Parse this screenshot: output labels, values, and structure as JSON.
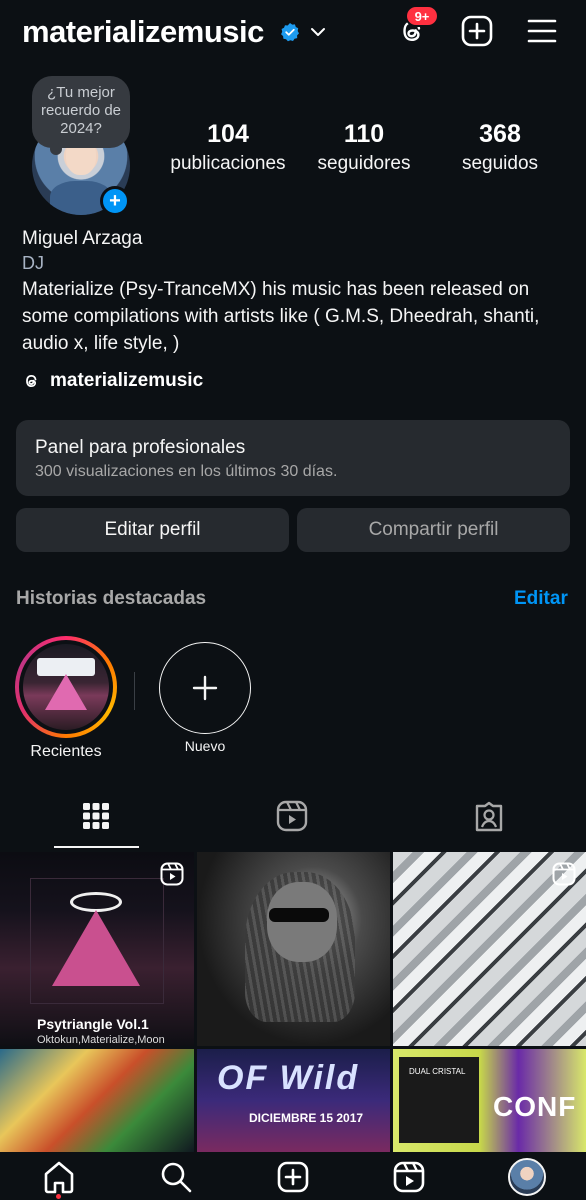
{
  "header": {
    "username": "materializemusic",
    "notification_badge": "9+",
    "icons": [
      "threads-icon",
      "create-icon",
      "menu-icon"
    ]
  },
  "profile": {
    "note": "¿Tu mejor recuerdo de 2024?",
    "stats": [
      {
        "value": "104",
        "label": "publicaciones"
      },
      {
        "value": "110",
        "label": "seguidores"
      },
      {
        "value": "368",
        "label": "seguidos"
      }
    ],
    "name": "Miguel Arzaga",
    "category": "DJ",
    "bio": "Materialize (Psy-TranceMX) his music has been released on some compilations with artists like  ( G.M.S, Dheedrah, shanti, audio x, life style,  )",
    "threads_handle": "materializemusic"
  },
  "pro_panel": {
    "title": "Panel para profesionales",
    "subtitle": "300 visualizaciones en los últimos 30 días."
  },
  "buttons": {
    "edit": "Editar perfil",
    "share": "Compartir perfil"
  },
  "highlights": {
    "title": "Historias destacadas",
    "edit": "Editar",
    "items": [
      {
        "label": "Recientes"
      },
      {
        "label": "Nuevo"
      }
    ]
  },
  "grid_posts": [
    {
      "caption_title": "Psytriangle Vol.1",
      "caption_sub": "Oktokun,Materialize,Moon"
    },
    {},
    {},
    {},
    {
      "text": "DICIEMBRE 15 2017"
    },
    {
      "text": "CONF"
    }
  ],
  "colors": {
    "background": "#0c1014",
    "accent": "#0095f6",
    "badge": "#ff3040",
    "surface": "#262a2f"
  }
}
